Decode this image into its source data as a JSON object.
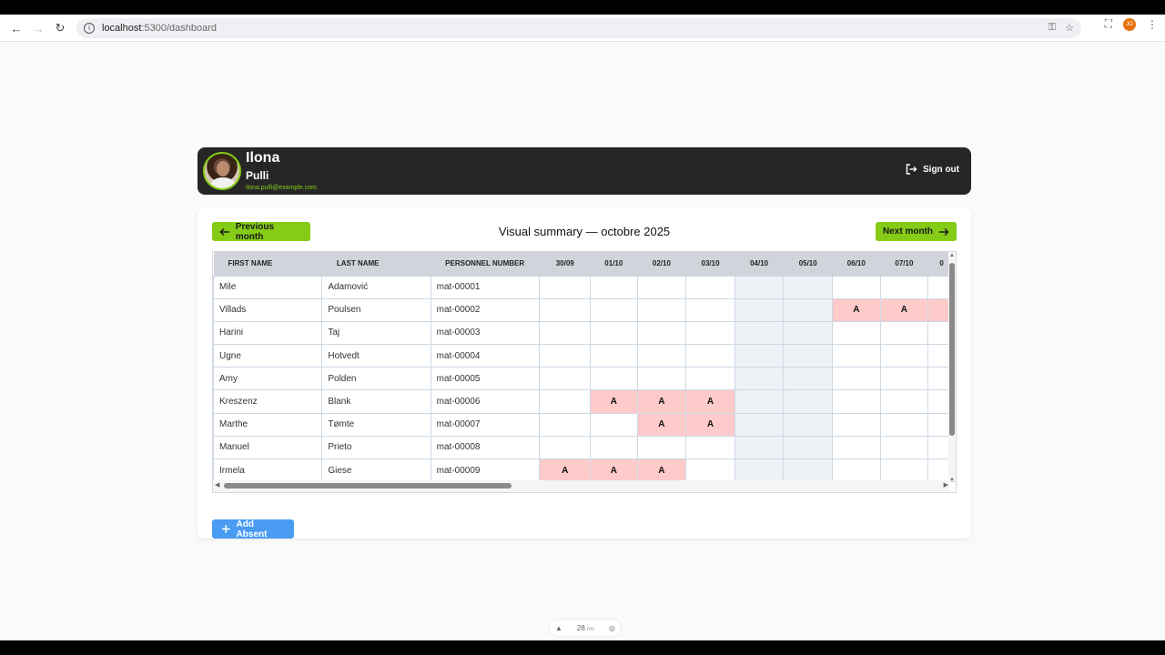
{
  "browser": {
    "url_host": "localhost",
    "url_rest": ":5300/dashboard",
    "profile_initials": "JO"
  },
  "user": {
    "first_name": "Ilona",
    "last_name": "Pulli",
    "email": "ilona.pulli@example.com",
    "sign_out_label": "Sign out"
  },
  "summary": {
    "prev_label": "Previous month",
    "next_label": "Next month",
    "title": "Visual summary — octobre 2025",
    "add_absent_label": "Add Absent"
  },
  "table": {
    "headers": {
      "first_name": "FIRST NAME",
      "last_name": "LAST NAME",
      "personnel_number": "PERSONNEL NUMBER"
    },
    "days": [
      "30/09",
      "01/10",
      "02/10",
      "03/10",
      "04/10",
      "05/10",
      "06/10",
      "07/10",
      "0"
    ],
    "weekend_day_indices": [
      4,
      5
    ],
    "rows": [
      {
        "first": "Mile",
        "last": "Adamović",
        "number": "mat-00001",
        "cells": [
          "",
          "",
          "",
          "",
          "",
          "",
          "",
          "",
          ""
        ]
      },
      {
        "first": "Villads",
        "last": "Poulsen",
        "number": "mat-00002",
        "cells": [
          "",
          "",
          "",
          "",
          "",
          "",
          "A",
          "A",
          ""
        ]
      },
      {
        "first": "Harini",
        "last": "Taj",
        "number": "mat-00003",
        "cells": [
          "",
          "",
          "",
          "",
          "",
          "",
          "",
          "",
          ""
        ]
      },
      {
        "first": "Ugne",
        "last": "Hotvedt",
        "number": "mat-00004",
        "cells": [
          "",
          "",
          "",
          "",
          "",
          "",
          "",
          "",
          ""
        ]
      },
      {
        "first": "Amy",
        "last": "Polden",
        "number": "mat-00005",
        "cells": [
          "",
          "",
          "",
          "",
          "",
          "",
          "",
          "",
          ""
        ]
      },
      {
        "first": "Kreszenz",
        "last": "Blank",
        "number": "mat-00006",
        "cells": [
          "",
          "A",
          "A",
          "A",
          "",
          "",
          "",
          "",
          ""
        ]
      },
      {
        "first": "Marthe",
        "last": "Tømte",
        "number": "mat-00007",
        "cells": [
          "",
          "",
          "A",
          "A",
          "",
          "",
          "",
          "",
          ""
        ]
      },
      {
        "first": "Manuel",
        "last": "Prieto",
        "number": "mat-00008",
        "cells": [
          "",
          "",
          "",
          "",
          "",
          "",
          "",
          "",
          ""
        ]
      },
      {
        "first": "Irmela",
        "last": "Giese",
        "number": "mat-00009",
        "cells": [
          "A",
          "A",
          "A",
          "",
          "",
          "",
          "",
          "",
          ""
        ]
      }
    ],
    "absent_flags": [
      [
        false,
        false,
        false,
        false,
        false,
        false,
        false,
        false,
        false
      ],
      [
        false,
        false,
        false,
        false,
        false,
        false,
        true,
        true,
        true
      ],
      [
        false,
        false,
        false,
        false,
        false,
        false,
        false,
        false,
        false
      ],
      [
        false,
        false,
        false,
        false,
        false,
        false,
        false,
        false,
        false
      ],
      [
        false,
        false,
        false,
        false,
        false,
        false,
        false,
        false,
        false
      ],
      [
        false,
        true,
        true,
        true,
        false,
        false,
        false,
        false,
        false
      ],
      [
        false,
        false,
        true,
        true,
        false,
        false,
        false,
        false,
        false
      ],
      [
        false,
        false,
        false,
        false,
        false,
        false,
        false,
        false,
        false
      ],
      [
        true,
        true,
        true,
        false,
        false,
        false,
        false,
        false,
        false
      ]
    ]
  },
  "devtools": {
    "ms_value": "28",
    "ms_unit": "ms"
  },
  "colors": {
    "accent_green": "#84cc16",
    "header_bg": "#262626",
    "absent_bg": "#fecaca",
    "weekend_bg": "#eef1f6",
    "add_button_bg": "#4a9cf3"
  }
}
